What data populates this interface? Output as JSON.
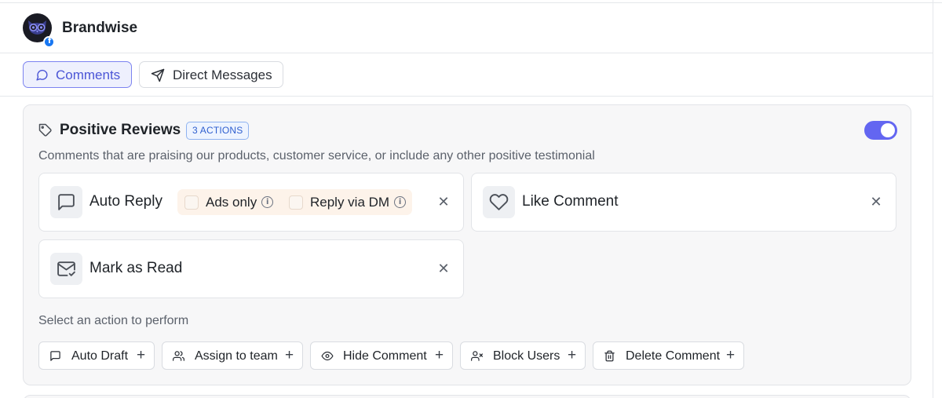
{
  "header": {
    "brand_name": "Brandwise",
    "avatar_icon": "owl-logo",
    "platform_badge": "f",
    "platform_icon": "facebook-icon"
  },
  "tabs": [
    {
      "label": "Comments",
      "icon": "chat-bubble-icon",
      "active": true
    },
    {
      "label": "Direct Messages",
      "icon": "send-icon",
      "active": false
    }
  ],
  "rule": {
    "title": "Positive Reviews",
    "badge": "3 ACTIONS",
    "enabled": true,
    "description": "Comments that are praising our products, customer service, or include any other positive testimonial",
    "actions": {
      "auto_reply": {
        "title": "Auto Reply",
        "options": [
          {
            "label": "Ads only",
            "checked": false
          },
          {
            "label": "Reply via DM",
            "checked": false
          }
        ]
      },
      "like_comment": {
        "title": "Like Comment"
      },
      "mark_as_read": {
        "title": "Mark as Read"
      }
    },
    "remove_symbol": "✕",
    "info_symbol": "i",
    "select_label": "Select an action to perform",
    "available_actions": [
      {
        "label": "Auto Draft",
        "icon": "chat-bubble-icon"
      },
      {
        "label": "Assign to team",
        "icon": "users-icon"
      },
      {
        "label": "Hide Comment",
        "icon": "eye-icon"
      },
      {
        "label": "Block Users",
        "icon": "user-block-icon"
      },
      {
        "label": "Delete Comment",
        "icon": "trash-icon"
      }
    ],
    "add_symbol": "+"
  },
  "colors": {
    "accent": "#6366f1",
    "active_tab_bg": "#eef0fd",
    "badge_blue": "#2f5fcf",
    "option_pill_bg": "#fdf3ea"
  }
}
